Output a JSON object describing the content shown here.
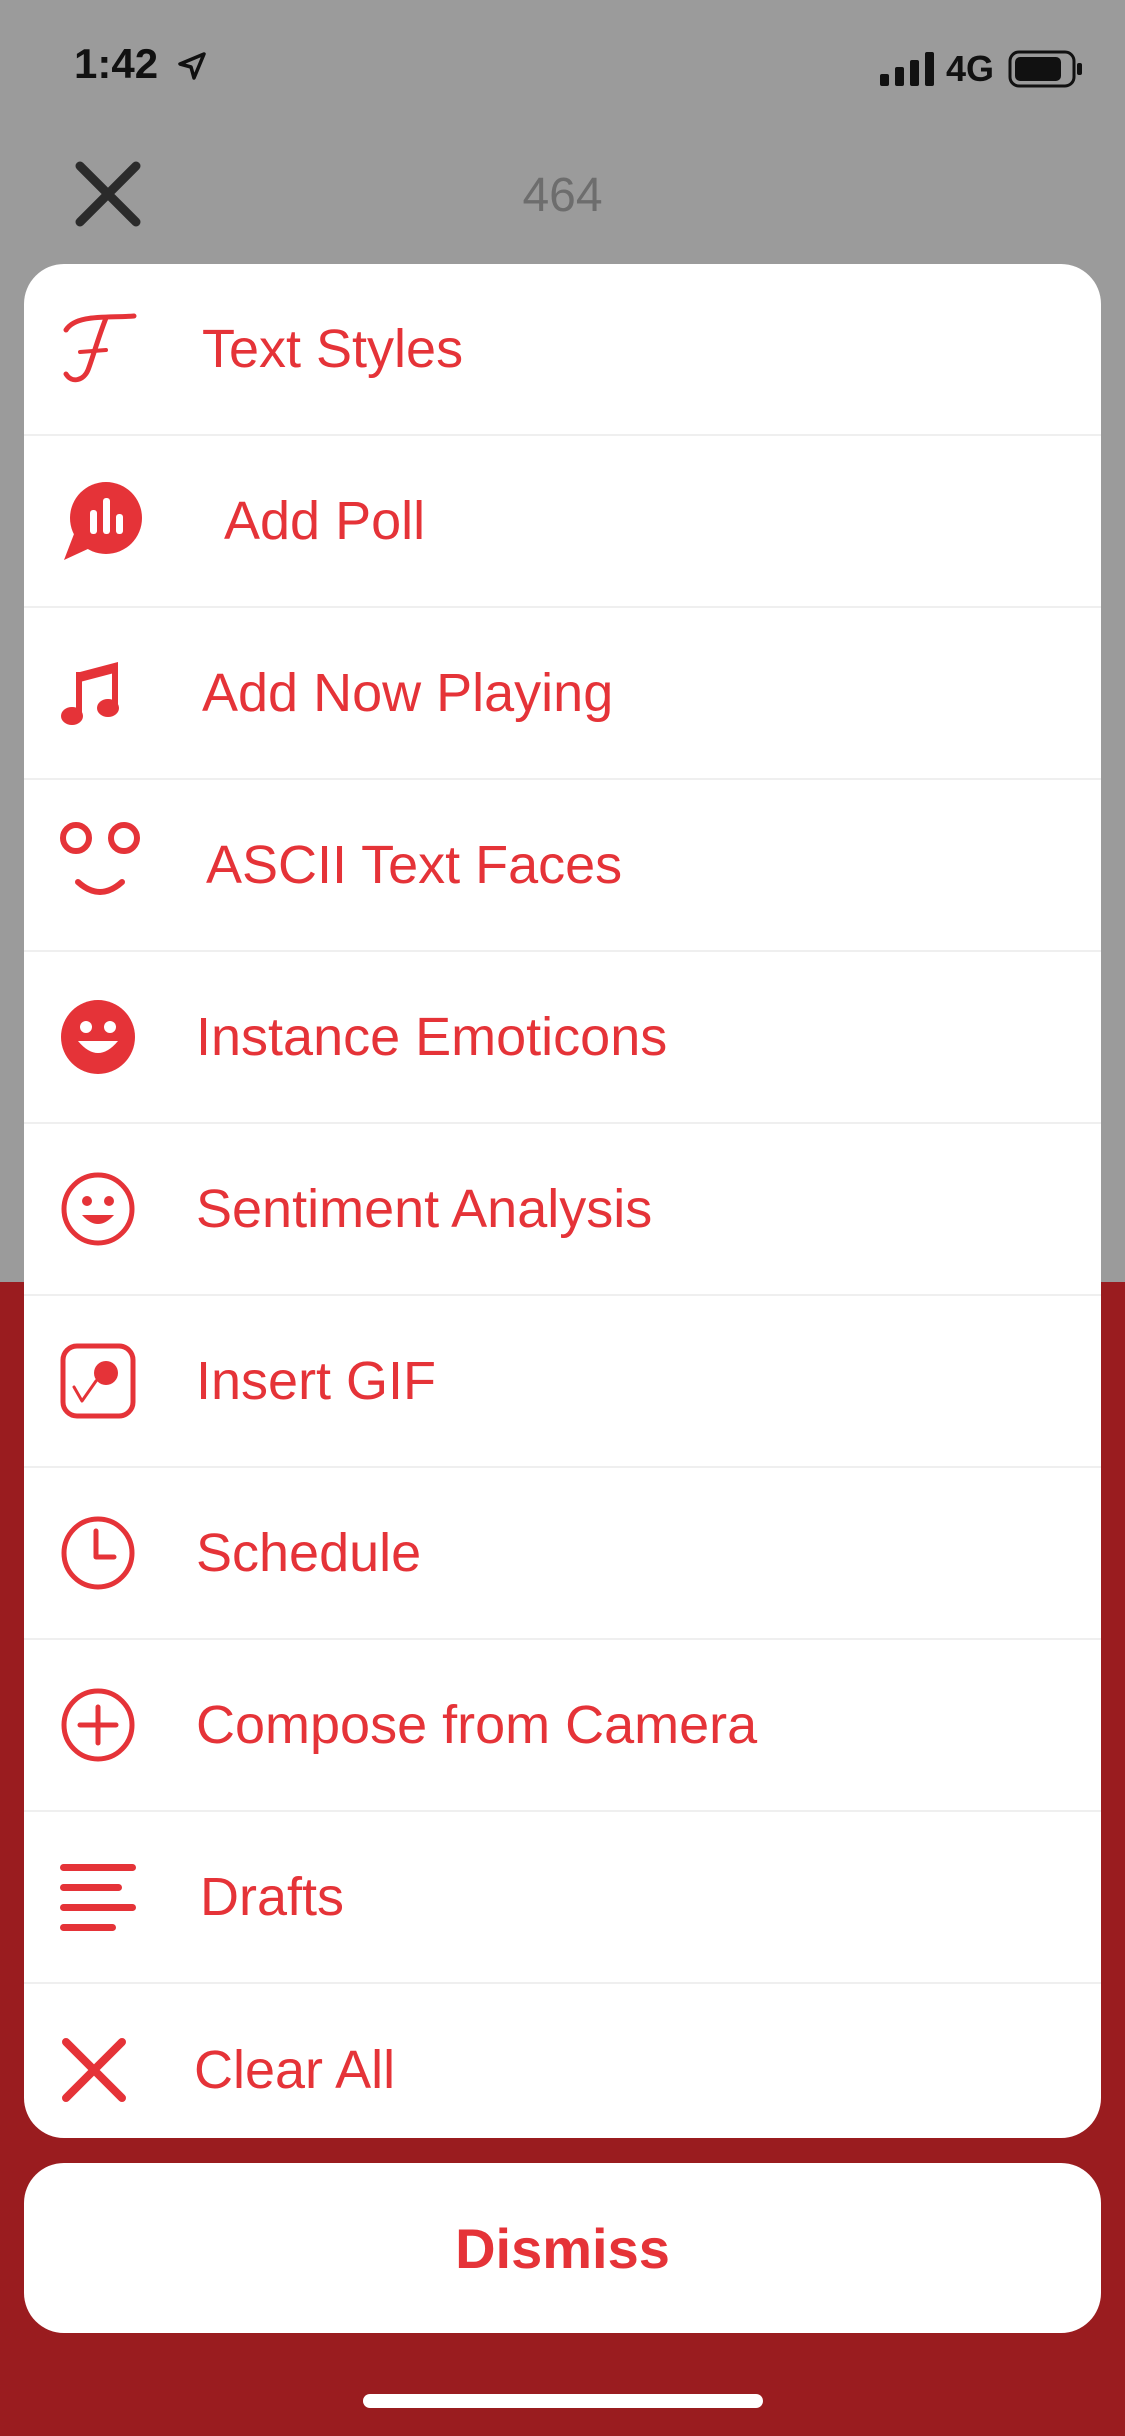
{
  "status_bar": {
    "time": "1:42",
    "network": "4G"
  },
  "header": {
    "char_count": "464"
  },
  "menu": {
    "items": [
      {
        "label": "Text Styles",
        "icon": "text-styles-icon"
      },
      {
        "label": "Add Poll",
        "icon": "poll-icon"
      },
      {
        "label": "Add Now Playing",
        "icon": "music-note-icon"
      },
      {
        "label": "ASCII Text Faces",
        "icon": "ascii-face-icon"
      },
      {
        "label": "Instance Emoticons",
        "icon": "emoticon-filled-icon"
      },
      {
        "label": "Sentiment Analysis",
        "icon": "smiley-outline-icon"
      },
      {
        "label": "Insert GIF",
        "icon": "gif-icon"
      },
      {
        "label": "Schedule",
        "icon": "clock-icon"
      },
      {
        "label": "Compose from Camera",
        "icon": "plus-circle-icon"
      },
      {
        "label": "Drafts",
        "icon": "drafts-lines-icon"
      },
      {
        "label": "Clear All",
        "icon": "clear-x-icon"
      }
    ]
  },
  "dismiss_label": "Dismiss",
  "colors": {
    "accent": "#e53338",
    "background_dim": "#9b9b9b",
    "background_brand": "#9a1c1f",
    "sheet": "#ffffff"
  }
}
